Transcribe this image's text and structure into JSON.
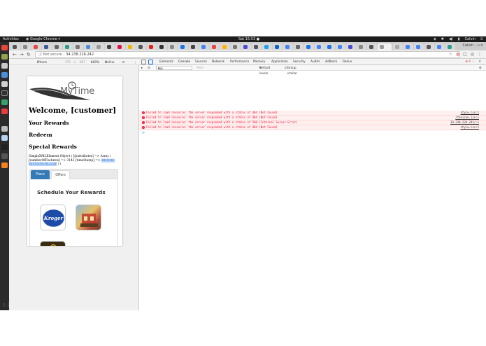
{
  "system": {
    "activities": "Activities",
    "app_menu": "Google Chrome",
    "clock": "Sat 15:53",
    "user": "Calvin"
  },
  "browser": {
    "not_secure": "Not secure",
    "url": "34.238.226.242"
  },
  "device_toolbar": {
    "device": "iPhone 6/7/8",
    "width": "375",
    "times": "×",
    "height": "667",
    "zoom": "100%",
    "network": "Online"
  },
  "page": {
    "logo_text": "MyTime",
    "welcome": "Welcome, [customer]",
    "nav": [
      "Your Rewards",
      "Redeem",
      "Special Rewards"
    ],
    "xml_dump_prefix": "SimpleXMLElement Object ( [@attributes] => Array ( [numberOfFeatures] => 3142 [timeStamp] =>",
    "xml_dump_highlight": "2019-03-02T15:53:18.212Z",
    "xml_dump_suffix": ") )",
    "tabs": [
      "Place",
      "Offers"
    ],
    "schedule_title": "Schedule Your Rewards",
    "tile_kroger": "Kroger"
  },
  "devtools": {
    "tabs": [
      "Elements",
      "Console",
      "Sources",
      "Network",
      "Performance",
      "Memory",
      "Application",
      "Security",
      "Audits",
      "AdBlock",
      "Redux"
    ],
    "active_tab": "Console",
    "error_count": "4",
    "context": "top",
    "filter_placeholder": "Filter",
    "levels": "Default levels",
    "group_similar": "Group similar",
    "errors": [
      {
        "msg": "Failed to load resource: the server responded with a status of 404 (Not Found)",
        "src": "style.css:1"
      },
      {
        "msg": "Failed to load resource: the server responded with a status of 404 (Not Found)",
        "src": "/favicon.ico:1"
      },
      {
        "msg": "Failed to load resource: the server responded with a status of 500 (Internal Server Error)",
        "src": "34.238.226.242/:1"
      },
      {
        "msg": "Failed to load resource: the server responded with a status of 404 (Not Found)",
        "src": "style.css:1"
      }
    ],
    "prompt": ">"
  },
  "colors": {
    "error_text": "#ee1133",
    "error_bg": "#fff0f0",
    "tab_active": "#337ab7"
  }
}
